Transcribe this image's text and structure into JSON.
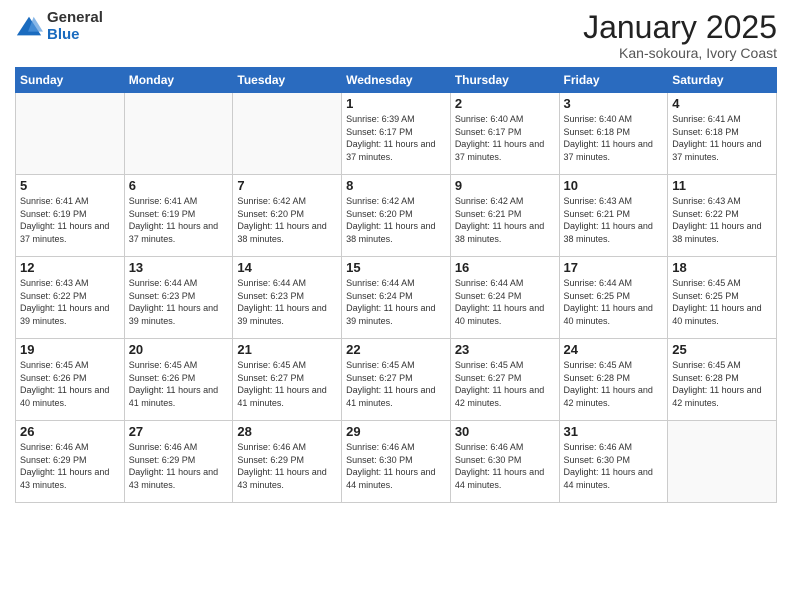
{
  "logo": {
    "general": "General",
    "blue": "Blue"
  },
  "header": {
    "month": "January 2025",
    "location": "Kan-sokoura, Ivory Coast"
  },
  "weekdays": [
    "Sunday",
    "Monday",
    "Tuesday",
    "Wednesday",
    "Thursday",
    "Friday",
    "Saturday"
  ],
  "weeks": [
    [
      {
        "day": "",
        "empty": true
      },
      {
        "day": "",
        "empty": true
      },
      {
        "day": "",
        "empty": true
      },
      {
        "day": "1",
        "sunrise": "6:39 AM",
        "sunset": "6:17 PM",
        "daylight": "11 hours and 37 minutes."
      },
      {
        "day": "2",
        "sunrise": "6:40 AM",
        "sunset": "6:17 PM",
        "daylight": "11 hours and 37 minutes."
      },
      {
        "day": "3",
        "sunrise": "6:40 AM",
        "sunset": "6:18 PM",
        "daylight": "11 hours and 37 minutes."
      },
      {
        "day": "4",
        "sunrise": "6:41 AM",
        "sunset": "6:18 PM",
        "daylight": "11 hours and 37 minutes."
      }
    ],
    [
      {
        "day": "5",
        "sunrise": "6:41 AM",
        "sunset": "6:19 PM",
        "daylight": "11 hours and 37 minutes."
      },
      {
        "day": "6",
        "sunrise": "6:41 AM",
        "sunset": "6:19 PM",
        "daylight": "11 hours and 37 minutes."
      },
      {
        "day": "7",
        "sunrise": "6:42 AM",
        "sunset": "6:20 PM",
        "daylight": "11 hours and 38 minutes."
      },
      {
        "day": "8",
        "sunrise": "6:42 AM",
        "sunset": "6:20 PM",
        "daylight": "11 hours and 38 minutes."
      },
      {
        "day": "9",
        "sunrise": "6:42 AM",
        "sunset": "6:21 PM",
        "daylight": "11 hours and 38 minutes."
      },
      {
        "day": "10",
        "sunrise": "6:43 AM",
        "sunset": "6:21 PM",
        "daylight": "11 hours and 38 minutes."
      },
      {
        "day": "11",
        "sunrise": "6:43 AM",
        "sunset": "6:22 PM",
        "daylight": "11 hours and 38 minutes."
      }
    ],
    [
      {
        "day": "12",
        "sunrise": "6:43 AM",
        "sunset": "6:22 PM",
        "daylight": "11 hours and 39 minutes."
      },
      {
        "day": "13",
        "sunrise": "6:44 AM",
        "sunset": "6:23 PM",
        "daylight": "11 hours and 39 minutes."
      },
      {
        "day": "14",
        "sunrise": "6:44 AM",
        "sunset": "6:23 PM",
        "daylight": "11 hours and 39 minutes."
      },
      {
        "day": "15",
        "sunrise": "6:44 AM",
        "sunset": "6:24 PM",
        "daylight": "11 hours and 39 minutes."
      },
      {
        "day": "16",
        "sunrise": "6:44 AM",
        "sunset": "6:24 PM",
        "daylight": "11 hours and 40 minutes."
      },
      {
        "day": "17",
        "sunrise": "6:44 AM",
        "sunset": "6:25 PM",
        "daylight": "11 hours and 40 minutes."
      },
      {
        "day": "18",
        "sunrise": "6:45 AM",
        "sunset": "6:25 PM",
        "daylight": "11 hours and 40 minutes."
      }
    ],
    [
      {
        "day": "19",
        "sunrise": "6:45 AM",
        "sunset": "6:26 PM",
        "daylight": "11 hours and 40 minutes."
      },
      {
        "day": "20",
        "sunrise": "6:45 AM",
        "sunset": "6:26 PM",
        "daylight": "11 hours and 41 minutes."
      },
      {
        "day": "21",
        "sunrise": "6:45 AM",
        "sunset": "6:27 PM",
        "daylight": "11 hours and 41 minutes."
      },
      {
        "day": "22",
        "sunrise": "6:45 AM",
        "sunset": "6:27 PM",
        "daylight": "11 hours and 41 minutes."
      },
      {
        "day": "23",
        "sunrise": "6:45 AM",
        "sunset": "6:27 PM",
        "daylight": "11 hours and 42 minutes."
      },
      {
        "day": "24",
        "sunrise": "6:45 AM",
        "sunset": "6:28 PM",
        "daylight": "11 hours and 42 minutes."
      },
      {
        "day": "25",
        "sunrise": "6:45 AM",
        "sunset": "6:28 PM",
        "daylight": "11 hours and 42 minutes."
      }
    ],
    [
      {
        "day": "26",
        "sunrise": "6:46 AM",
        "sunset": "6:29 PM",
        "daylight": "11 hours and 43 minutes."
      },
      {
        "day": "27",
        "sunrise": "6:46 AM",
        "sunset": "6:29 PM",
        "daylight": "11 hours and 43 minutes."
      },
      {
        "day": "28",
        "sunrise": "6:46 AM",
        "sunset": "6:29 PM",
        "daylight": "11 hours and 43 minutes."
      },
      {
        "day": "29",
        "sunrise": "6:46 AM",
        "sunset": "6:30 PM",
        "daylight": "11 hours and 44 minutes."
      },
      {
        "day": "30",
        "sunrise": "6:46 AM",
        "sunset": "6:30 PM",
        "daylight": "11 hours and 44 minutes."
      },
      {
        "day": "31",
        "sunrise": "6:46 AM",
        "sunset": "6:30 PM",
        "daylight": "11 hours and 44 minutes."
      },
      {
        "day": "",
        "empty": true
      }
    ]
  ],
  "labels": {
    "sunrise": "Sunrise:",
    "sunset": "Sunset:",
    "daylight": "Daylight:"
  }
}
